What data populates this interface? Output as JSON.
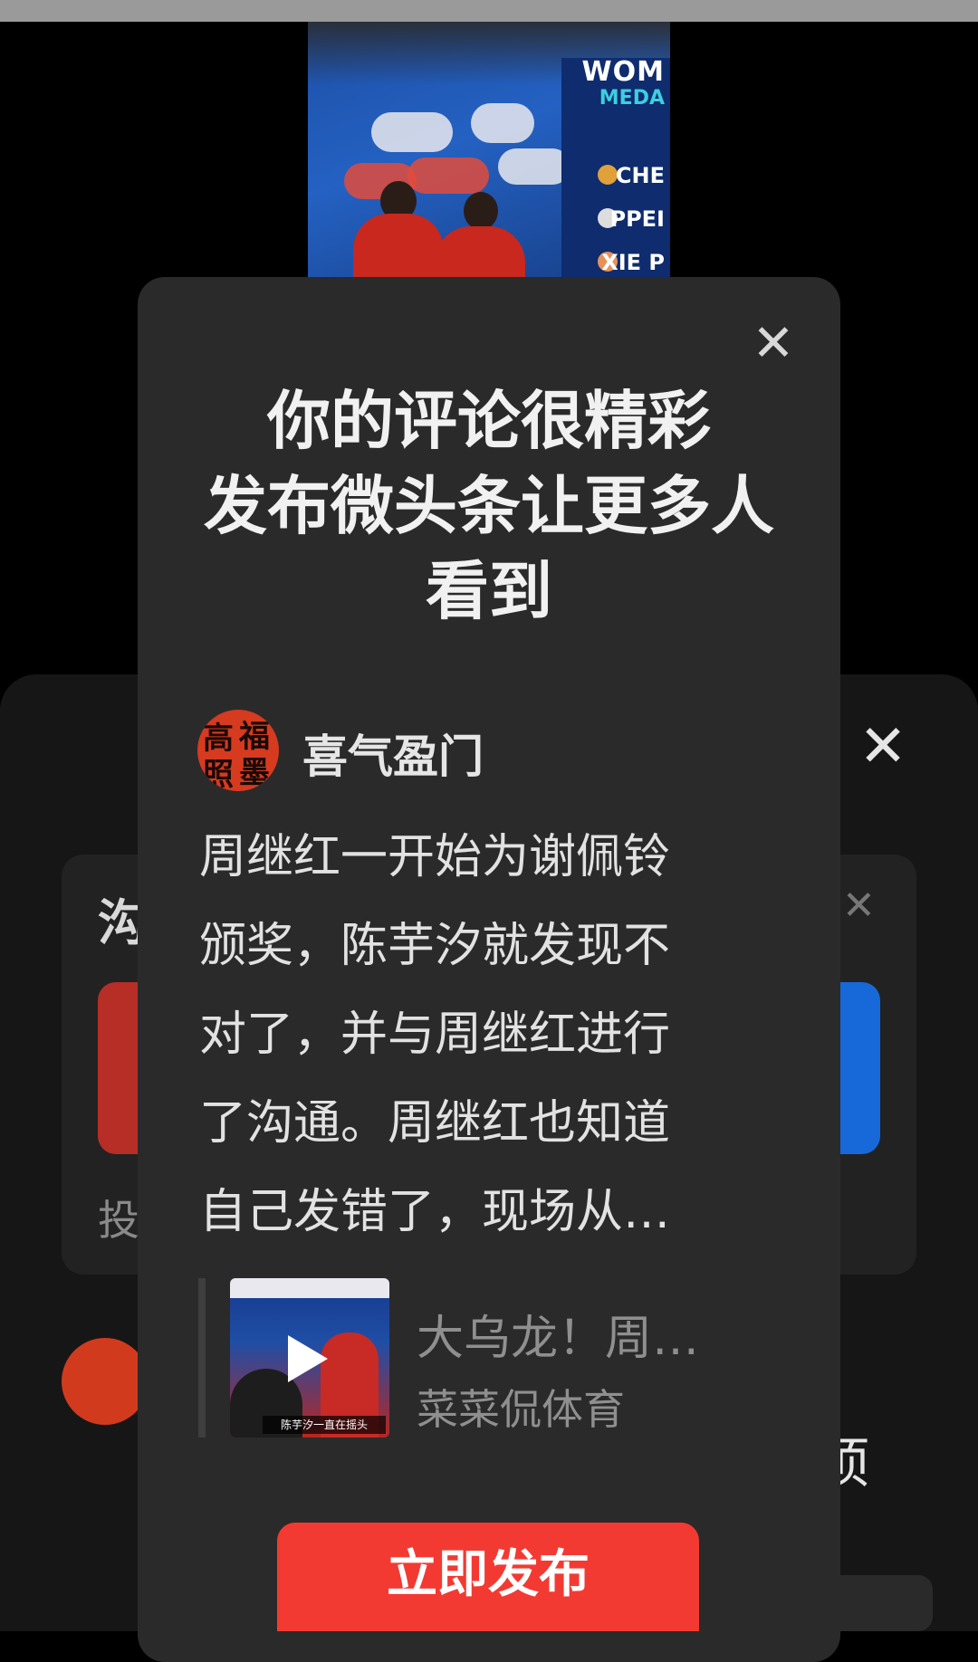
{
  "video": {
    "brand": "WOM",
    "brand_sub": "MEDA",
    "ranks": [
      "CHE",
      "PPEI",
      "XIE P"
    ]
  },
  "background_panel": {
    "card_title_partial": "沟",
    "footer_partial": "投",
    "right_text_partial": "顷"
  },
  "modal": {
    "title_lines": [
      "你的评论很精彩",
      "发布微头条让更多人",
      "看到"
    ],
    "author": {
      "name": "喜气盈门",
      "avatar_glyphs": [
        "高",
        "福",
        "照",
        "墨"
      ]
    },
    "comment_lines": [
      "周继红一开始为谢佩铃",
      "颁奖，陈芋汐就发现不",
      "对了，并与周继红进行",
      "了沟通。周继红也知道",
      "自己发错了，现场从…"
    ],
    "quote": {
      "title": "大乌龙！周…",
      "author": "菜菜侃体育",
      "thumb_caption": "陈芋汐一直在摇头"
    },
    "publish_label": "立即发布",
    "close_glyph": "✕"
  },
  "colors": {
    "accent": "#f33a32",
    "modal_bg": "#2a2a2b",
    "panel_bg": "#161616"
  }
}
